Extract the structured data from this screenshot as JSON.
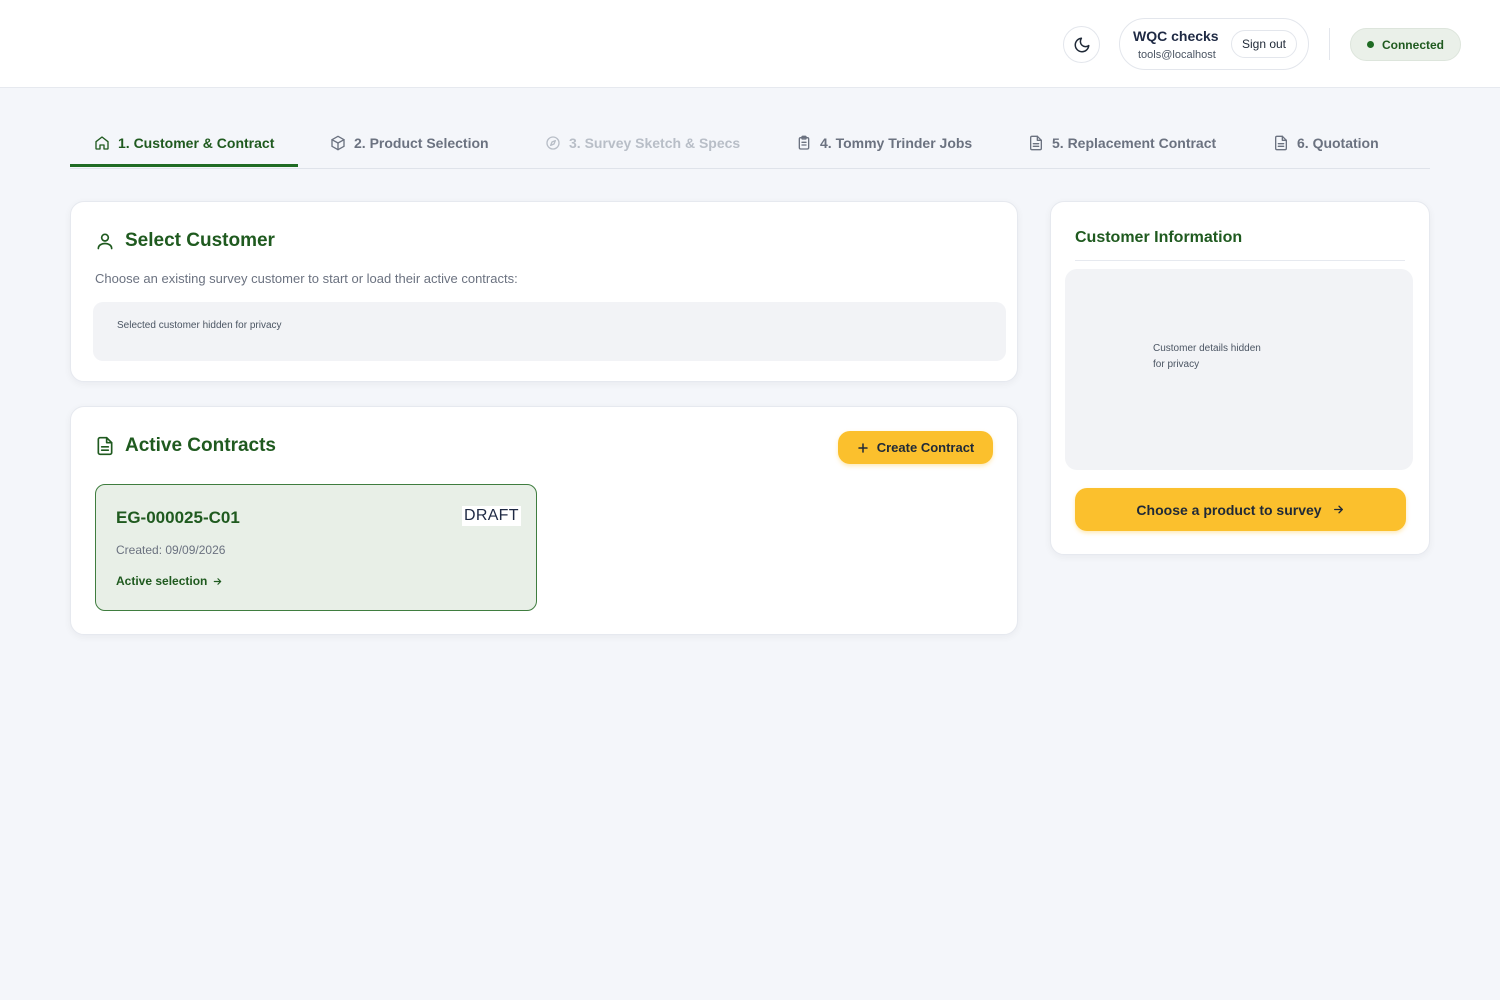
{
  "header": {
    "user_name": "WQC checks",
    "user_email": "tools@localhost",
    "sign_out_label": "Sign out",
    "status_label": "Connected"
  },
  "tabs": [
    {
      "label": "1. Customer & Contract",
      "icon": "home-icon",
      "state": "active"
    },
    {
      "label": "2. Product Selection",
      "icon": "cube-icon",
      "state": "normal"
    },
    {
      "label": "3. Survey Sketch & Specs",
      "icon": "compass-icon",
      "state": "disabled"
    },
    {
      "label": "4. Tommy Trinder Jobs",
      "icon": "clipboard-icon",
      "state": "normal"
    },
    {
      "label": "5. Replacement Contract",
      "icon": "document-icon",
      "state": "normal"
    },
    {
      "label": "6. Quotation",
      "icon": "document-icon",
      "state": "normal"
    }
  ],
  "select_customer": {
    "title": "Select Customer",
    "subtitle": "Choose an existing survey customer to start or load their active contracts:",
    "privacy_text": "Selected customer hidden for privacy"
  },
  "active_contracts": {
    "title": "Active Contracts",
    "create_label": "Create Contract",
    "contracts": [
      {
        "id": "EG-000025-C01",
        "status": "DRAFT",
        "created": "Created: 09/09/2026",
        "link_label": "Active selection"
      }
    ]
  },
  "customer_info": {
    "title": "Customer Information",
    "privacy_text": "Customer details hidden for privacy",
    "button_label": "Choose a product to survey"
  },
  "colors": {
    "brand_green": "#1f5a1f",
    "accent_yellow": "#fbc02d",
    "background": "#f4f6fa"
  }
}
